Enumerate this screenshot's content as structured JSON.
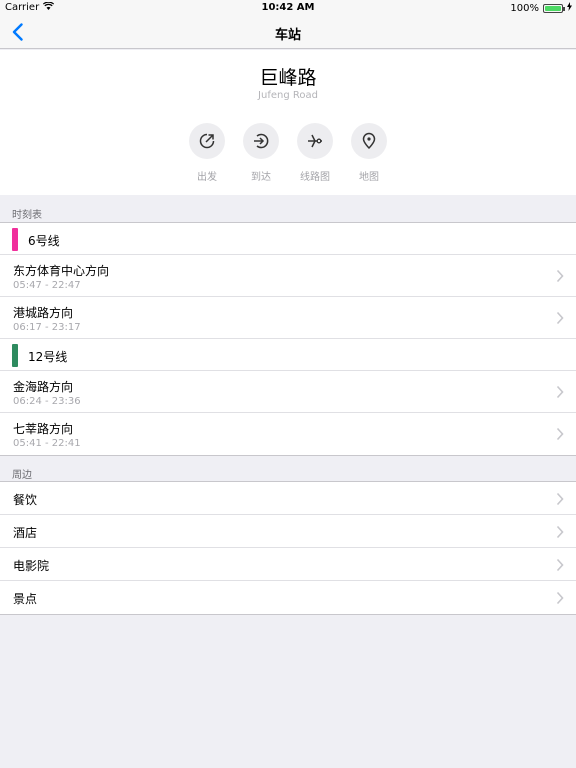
{
  "status": {
    "carrier": "Carrier",
    "time": "10:42 AM",
    "battery": "100%",
    "battery_level": 1.0
  },
  "nav": {
    "title": "车站"
  },
  "station": {
    "name": "巨峰路",
    "name_en": "Jufeng Road"
  },
  "actions": [
    {
      "label": "出发",
      "icon": "depart-icon"
    },
    {
      "label": "到达",
      "icon": "arrive-icon"
    },
    {
      "label": "线路图",
      "icon": "route-map-icon"
    },
    {
      "label": "地图",
      "icon": "map-pin-icon"
    }
  ],
  "timetable": {
    "header": "时刻表",
    "lines": [
      {
        "name": "6号线",
        "color": "#f02f9c",
        "directions": [
          {
            "title": "东方体育中心方向",
            "time": "05:47 - 22:47"
          },
          {
            "title": "港城路方向",
            "time": "06:17 - 23:17"
          }
        ]
      },
      {
        "name": "12号线",
        "color": "#2e8b5f",
        "directions": [
          {
            "title": "金海路方向",
            "time": "06:24 - 23:36"
          },
          {
            "title": "七莘路方向",
            "time": "05:41 - 22:41"
          }
        ]
      }
    ]
  },
  "nearby": {
    "header": "周边",
    "items": [
      "餐饮",
      "酒店",
      "电影院",
      "景点"
    ]
  },
  "colors": {
    "accent": "#007aff"
  }
}
